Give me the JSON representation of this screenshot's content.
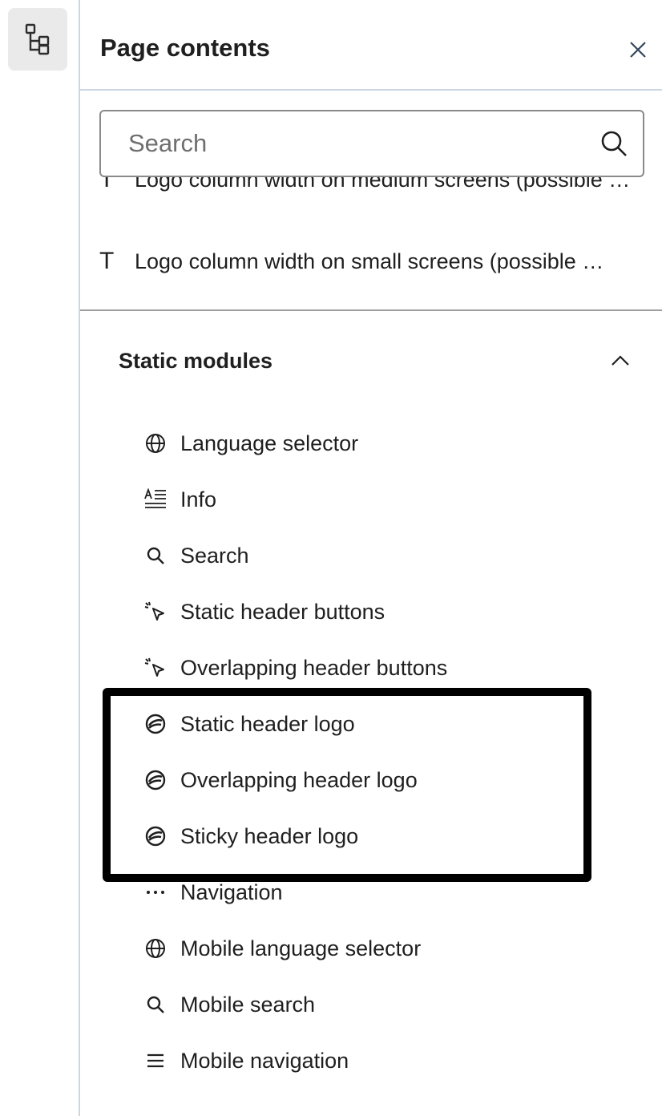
{
  "rail": {
    "tree_button_icon": "tree-structure-icon"
  },
  "panel": {
    "title": "Page contents",
    "close_icon": "close-icon"
  },
  "search": {
    "placeholder": "Search",
    "value": "",
    "icon": "search-icon"
  },
  "fields": [
    {
      "icon": "text-field-icon",
      "label": "Logo column width on medium screens (possible …"
    },
    {
      "icon": "text-field-icon",
      "label": "Logo column width on small screens (possible …"
    }
  ],
  "static_modules": {
    "title": "Static modules",
    "expanded": true,
    "items": [
      {
        "icon": "globe-icon",
        "label": "Language selector"
      },
      {
        "icon": "rich-text-icon",
        "label": "Info"
      },
      {
        "icon": "search-icon",
        "label": "Search"
      },
      {
        "icon": "click-cursor-icon",
        "label": "Static header buttons"
      },
      {
        "icon": "click-cursor-icon",
        "label": "Overlapping header buttons"
      },
      {
        "icon": "logo-icon",
        "label": "Static header logo"
      },
      {
        "icon": "logo-icon",
        "label": "Overlapping header logo"
      },
      {
        "icon": "logo-icon",
        "label": "Sticky header logo"
      },
      {
        "icon": "more-dots-icon",
        "label": "Navigation"
      },
      {
        "icon": "globe-icon",
        "label": "Mobile language selector"
      },
      {
        "icon": "search-icon",
        "label": "Mobile search"
      },
      {
        "icon": "menu-lines-icon",
        "label": "Mobile navigation"
      }
    ]
  },
  "colors": {
    "highlight_border": "#000000",
    "rail_button_bg": "#eaeaea",
    "divider": "#cbd6e2"
  }
}
